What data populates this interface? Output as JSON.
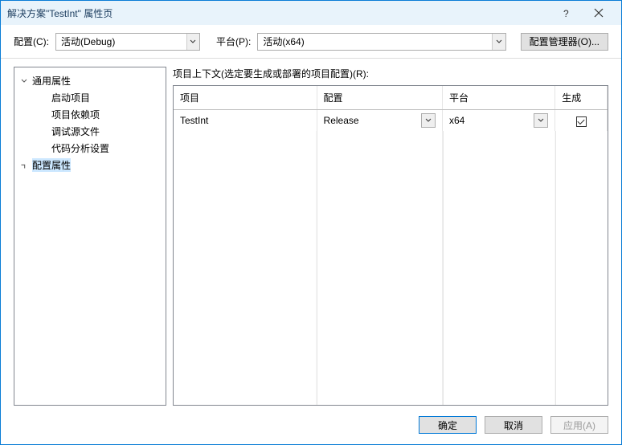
{
  "titlebar": {
    "title": "解决方案\"TestInt\" 属性页"
  },
  "toolbar": {
    "config_label": "配置(C):",
    "config_value": "活动(Debug)",
    "platform_label": "平台(P):",
    "platform_value": "活动(x64)",
    "manager_button": "配置管理器(O)..."
  },
  "tree": {
    "group1": {
      "label": "通用属性",
      "expanded": true
    },
    "children": [
      {
        "label": "启动项目"
      },
      {
        "label": "项目依赖项"
      },
      {
        "label": "调试源文件"
      },
      {
        "label": "代码分析设置"
      }
    ],
    "group2": {
      "label": "配置属性",
      "expanded": false,
      "selected": true
    }
  },
  "main": {
    "context_label": "项目上下文(选定要生成或部署的项目配置)(R):",
    "columns": {
      "project": "项目",
      "config": "配置",
      "platform": "平台",
      "build": "生成"
    },
    "rows": [
      {
        "project": "TestInt",
        "config": "Release",
        "platform": "x64",
        "build": true
      }
    ]
  },
  "footer": {
    "ok": "确定",
    "cancel": "取消",
    "apply": "应用(A)"
  }
}
